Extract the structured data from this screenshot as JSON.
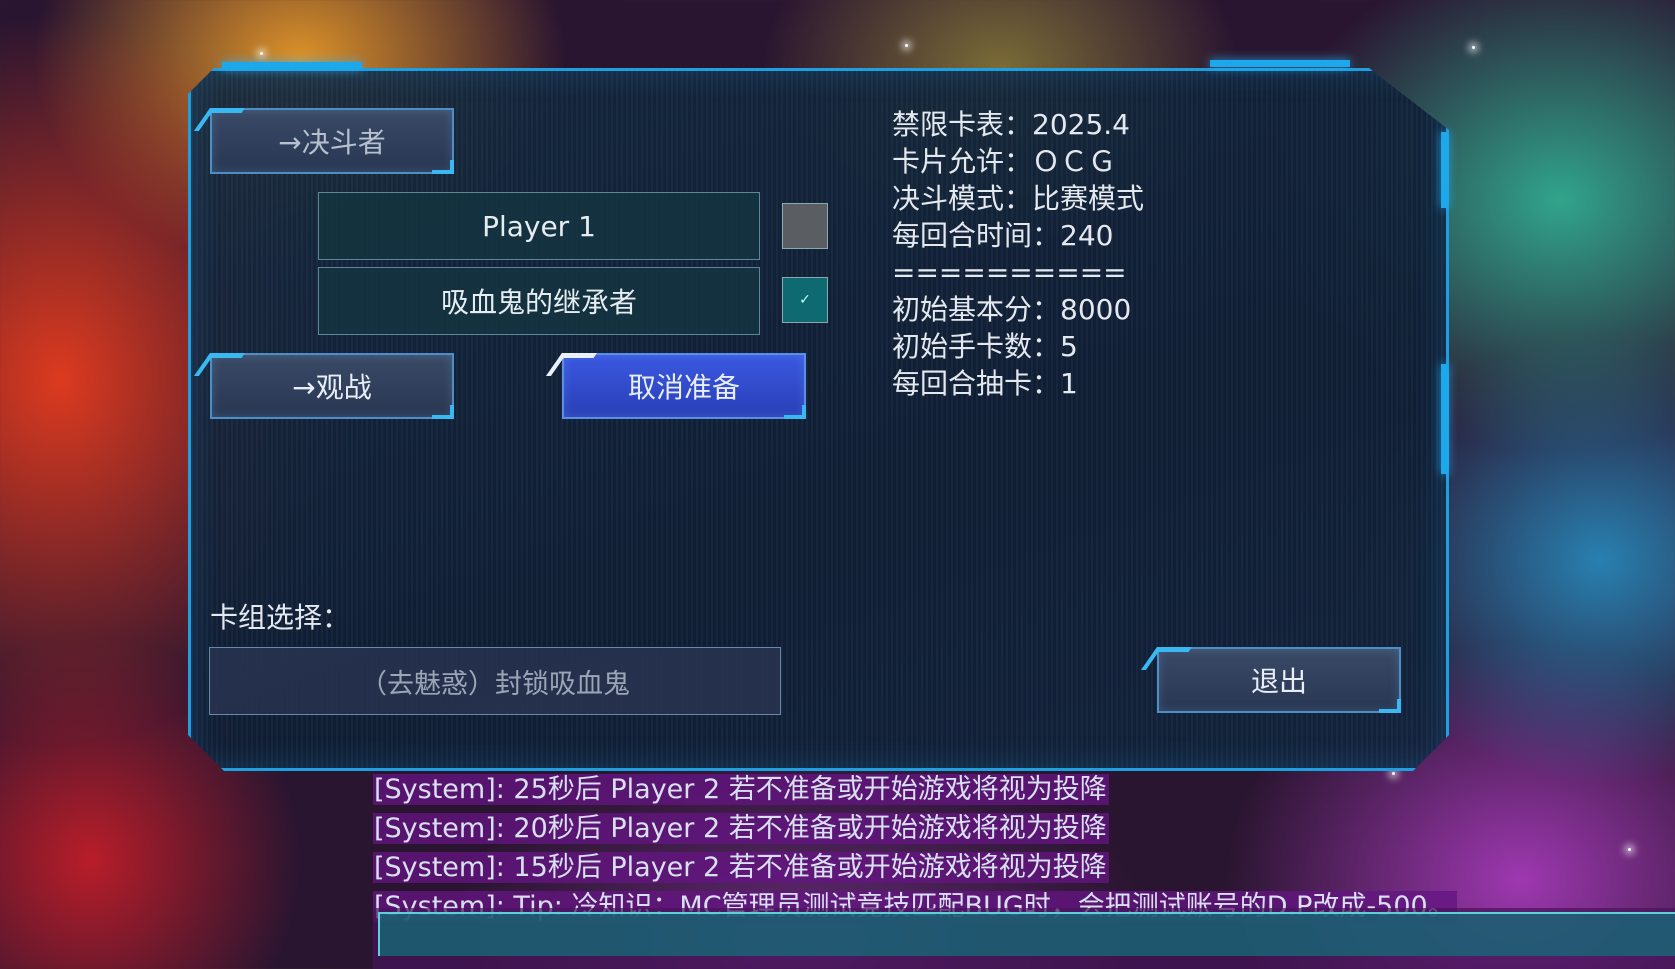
{
  "lobby": {
    "duelist_button": "→决斗者",
    "spectate_button": "→观战",
    "cancel_ready_button": "取消准备",
    "exit_button": "退出",
    "players": [
      {
        "name": "Player 1",
        "ready": false
      },
      {
        "name": "吸血鬼的继承者",
        "ready": true
      }
    ],
    "ready_check_mark": "✓"
  },
  "room_info": {
    "banlist": "禁限卡表：2025.4",
    "card_pool": "卡片允许：ＯＣＧ",
    "duel_mode": "决斗模式：比赛模式",
    "turn_time": "每回合时间：240",
    "separator": "==========",
    "start_lp": "初始基本分：8000",
    "start_hand": "初始手卡数：5",
    "draw_count": "每回合抽卡：1"
  },
  "deck": {
    "label": "卡组选择：",
    "selected": "（去魅惑）封锁吸血鬼"
  },
  "chat": {
    "messages": [
      "[System]: 25秒后 Player 2 若不准备或开始游戏将视为投降",
      "[System]: 20秒后 Player 2 若不准备或开始游戏将视为投降",
      "[System]: 15秒后 Player 2 若不准备或开始游戏将视为投降",
      "[System]: Tip: 冷知识：MC管理员测试竞技匹配BUG时，会把测试账号的D.P改成-500。"
    ],
    "input_value": ""
  }
}
